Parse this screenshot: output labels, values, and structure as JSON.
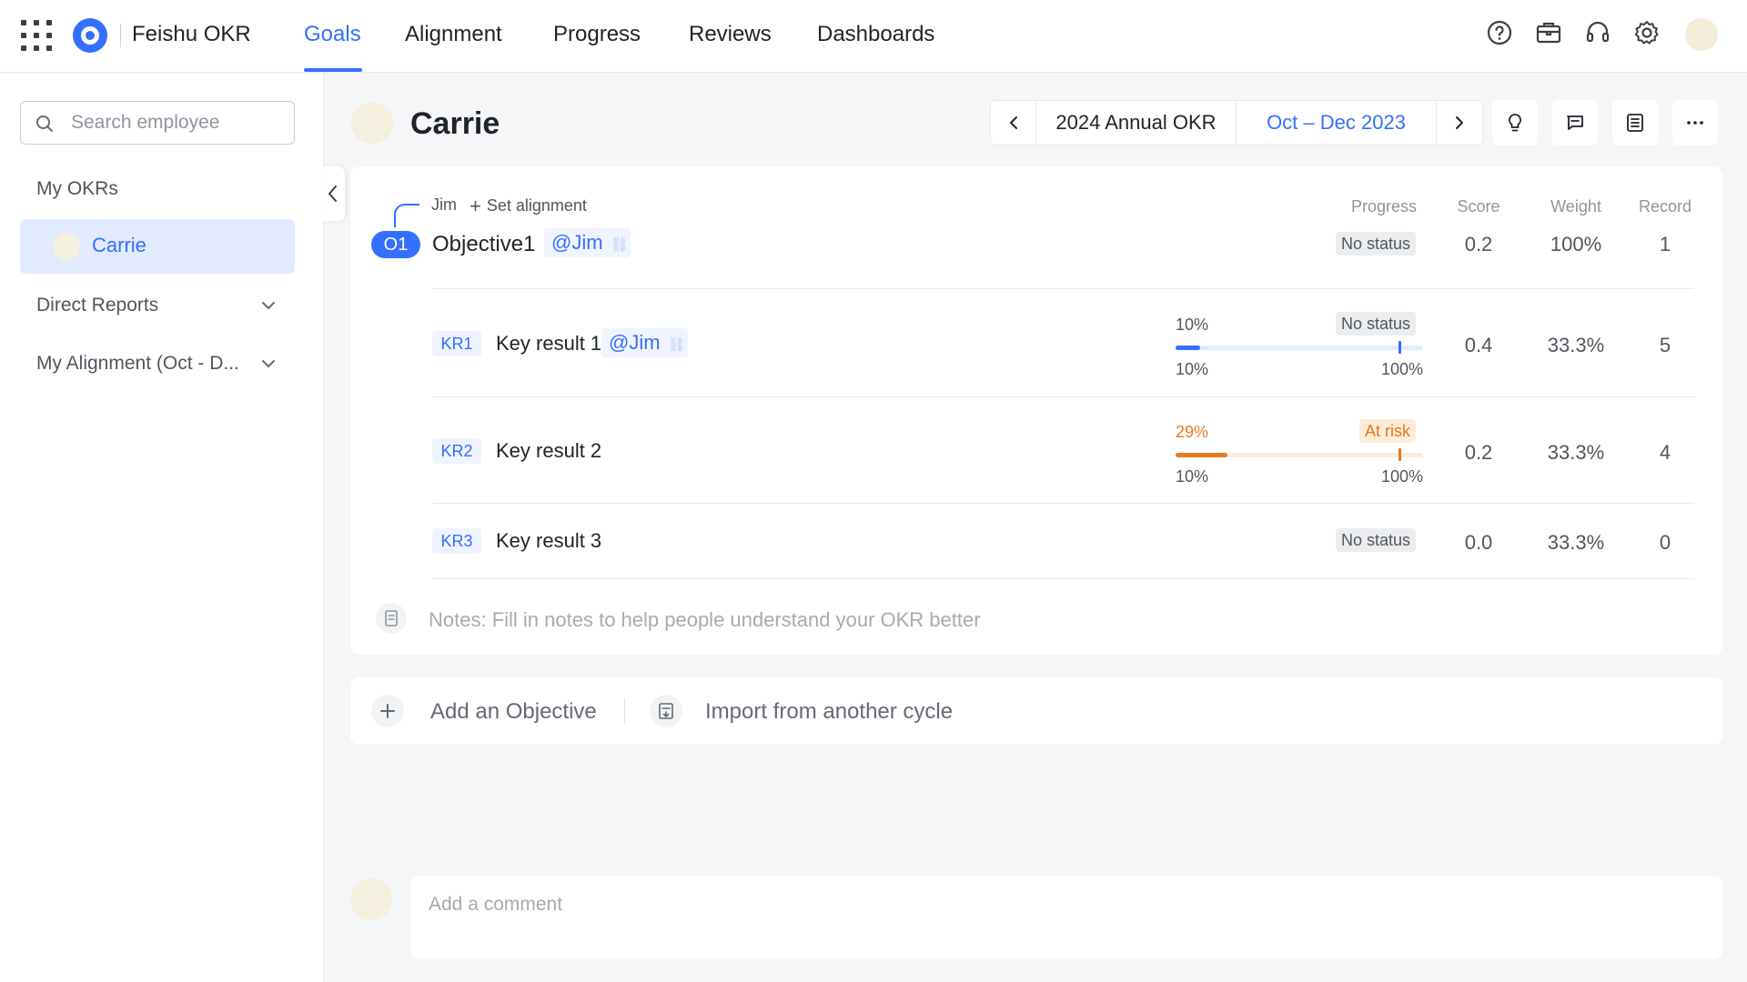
{
  "app": {
    "name": "Feishu OKR",
    "accent": "#3370ff"
  },
  "nav": {
    "tabs": [
      "Goals",
      "Alignment",
      "Progress",
      "Reviews",
      "Dashboards"
    ],
    "active": "Goals"
  },
  "sidebar": {
    "search_placeholder": "Search employee",
    "my_okrs": "My OKRs",
    "current_user": "Carrie",
    "direct_reports": "Direct Reports",
    "my_alignment": "My Alignment (Oct - D..."
  },
  "header": {
    "owner": "Carrie",
    "cycle_year": "2024 Annual OKR",
    "cycle_quarter": "Oct – Dec 2023"
  },
  "columns": {
    "progress": "Progress",
    "score": "Score",
    "weight": "Weight",
    "record": "Record"
  },
  "objective": {
    "aligned_to": "Jim",
    "set_alignment": "Set alignment",
    "badge": "O1",
    "title": "Objective1",
    "mention": "@Jim",
    "status": "No status",
    "score": "0.2",
    "weight": "100%",
    "record": "1"
  },
  "key_results": [
    {
      "badge": "KR1",
      "title": "Key result 1",
      "mention": "@Jim",
      "status": "No status",
      "current": "10%",
      "start": "10%",
      "target": "100%",
      "score": "0.4",
      "weight": "33.3%",
      "record": "5",
      "progress_fraction": 0.1,
      "status_color": "#3370ff"
    },
    {
      "badge": "KR2",
      "title": "Key result 2",
      "status": "At risk",
      "current": "29%",
      "start": "10%",
      "target": "100%",
      "score": "0.2",
      "weight": "33.3%",
      "record": "4",
      "progress_fraction": 0.21,
      "status_color": "#e6781f"
    },
    {
      "badge": "KR3",
      "title": "Key result 3",
      "status": "No status",
      "score": "0.0",
      "weight": "33.3%",
      "record": "0"
    }
  ],
  "notes": {
    "text": "Notes:  Fill in notes to help people understand your OKR better"
  },
  "actions": {
    "add_objective": "Add an Objective",
    "import": "Import from another cycle"
  },
  "comment": {
    "placeholder": "Add a comment"
  }
}
